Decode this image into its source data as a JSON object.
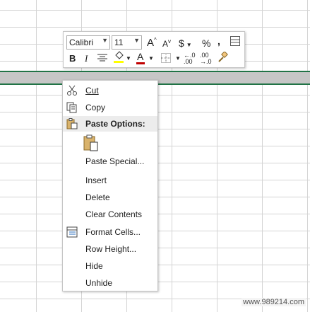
{
  "mini_toolbar": {
    "font_name": "Calibri",
    "font_size": "11",
    "grow_font_label": "A",
    "shrink_font_label": "A",
    "currency_label": "$",
    "percent_label": "%",
    "comma_label": ",",
    "bold_label": "B",
    "italic_label": "I",
    "font_color_label": "A",
    "inc_decimal_label": "←.0 .00",
    "dec_decimal_label": ".00 →.0"
  },
  "context_menu": {
    "items": [
      {
        "label": "Cut",
        "icon": "scissors-icon"
      },
      {
        "label": "Copy",
        "icon": "copy-icon"
      },
      {
        "label": "Paste Options:",
        "icon": "paste-icon"
      },
      {
        "label": "Paste Special...",
        "icon": ""
      },
      {
        "label": "Insert",
        "icon": ""
      },
      {
        "label": "Delete",
        "icon": ""
      },
      {
        "label": "Clear Contents",
        "icon": ""
      },
      {
        "label": "Format Cells...",
        "icon": "format-cells-icon"
      },
      {
        "label": "Row Height...",
        "icon": ""
      },
      {
        "label": "Hide",
        "icon": ""
      },
      {
        "label": "Unhide",
        "icon": ""
      }
    ]
  },
  "watermark": "www.989214.com",
  "colors": {
    "selection_border": "#217346",
    "selected_row": "#c6c6c6",
    "highlight_yellow": "#ffff00",
    "font_red": "#c00000"
  }
}
